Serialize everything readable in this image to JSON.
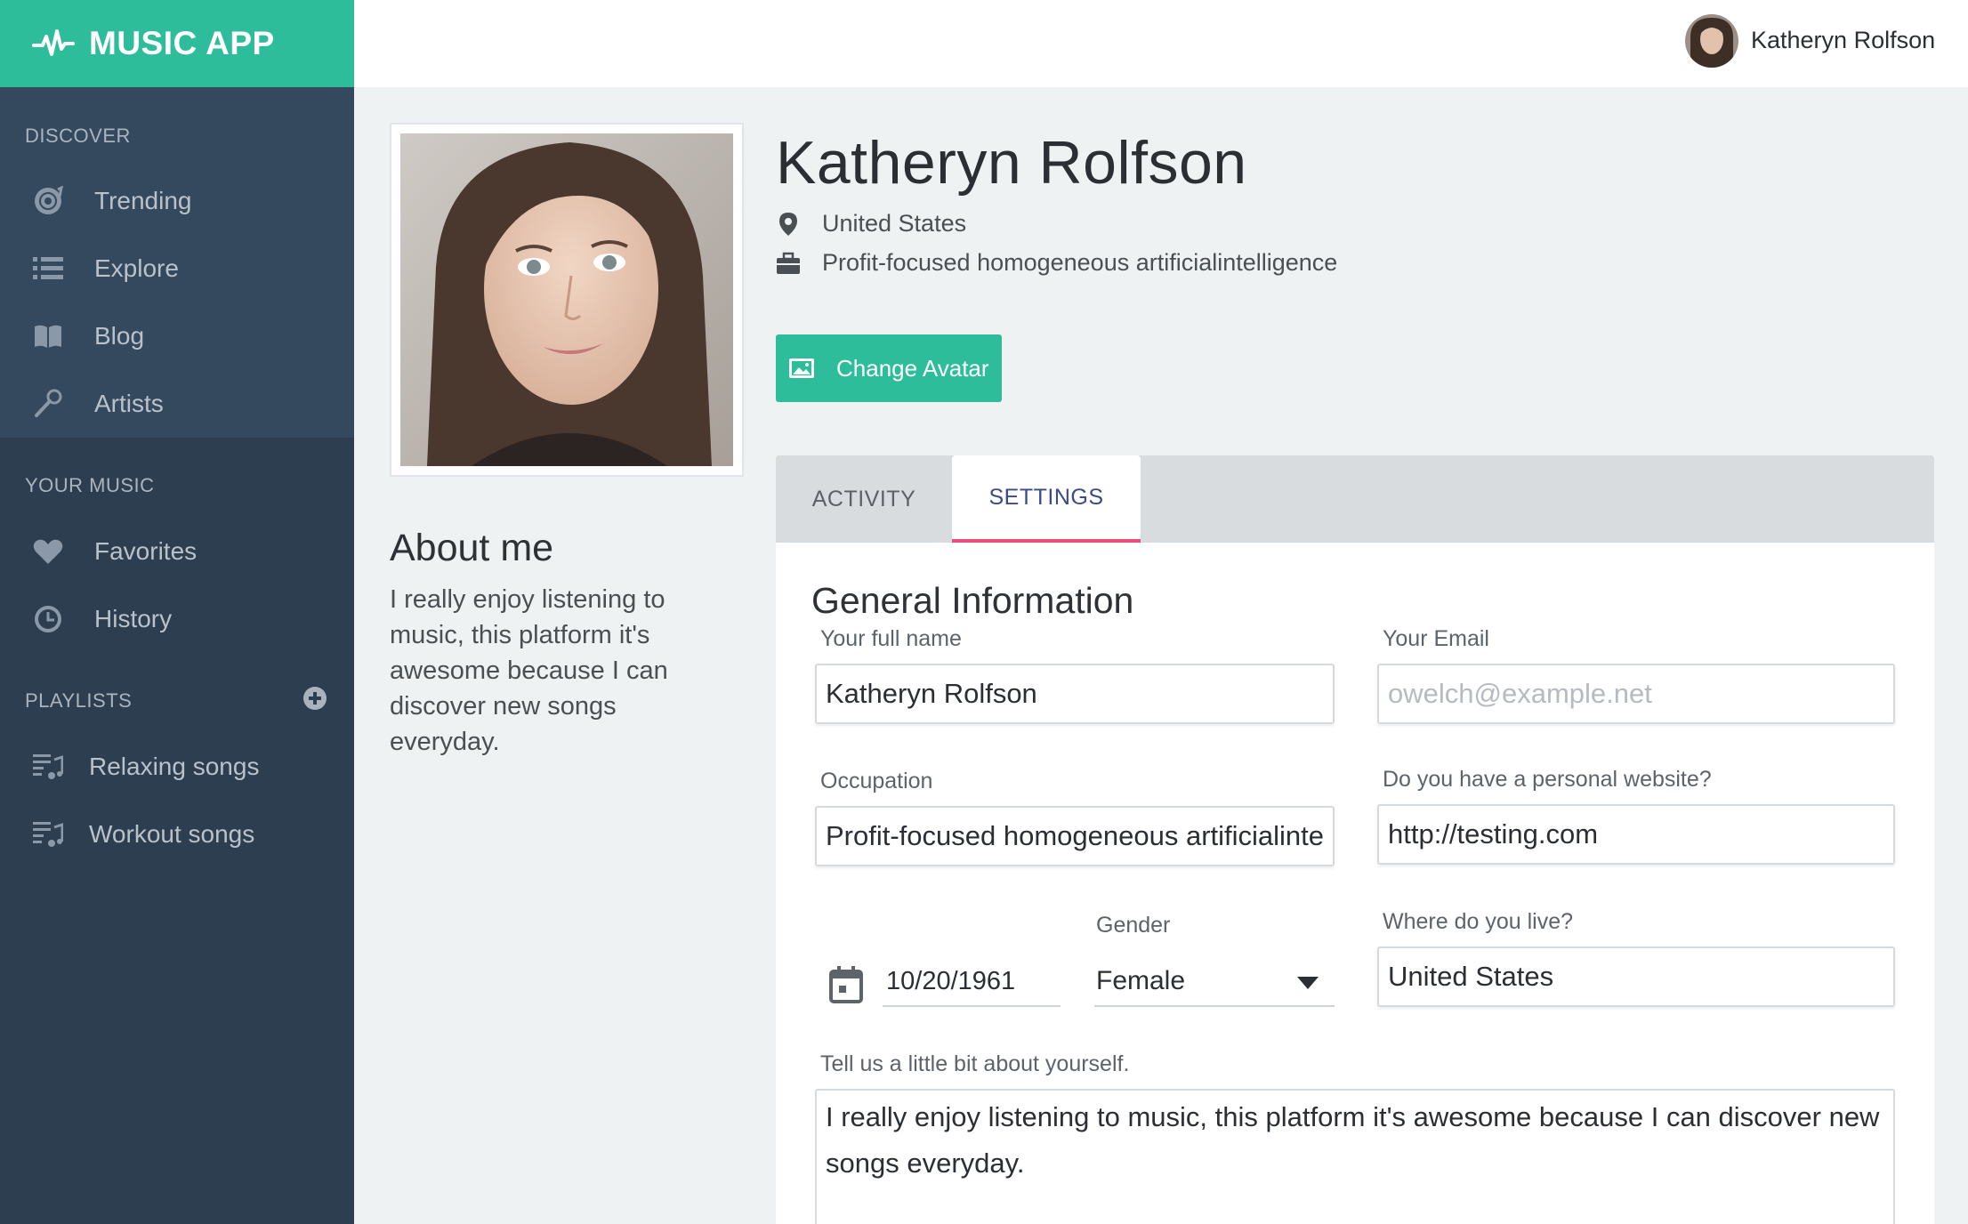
{
  "brand": {
    "name": "MUSIC APP",
    "color": "#2ebd9b"
  },
  "sidebar": {
    "discover_title": "DISCOVER",
    "discover": [
      {
        "label": "Trending",
        "icon": "disc-icon"
      },
      {
        "label": "Explore",
        "icon": "list-icon"
      },
      {
        "label": "Blog",
        "icon": "book-icon"
      },
      {
        "label": "Artists",
        "icon": "microphone-icon"
      }
    ],
    "your_music_title": "YOUR MUSIC",
    "your_music": [
      {
        "label": "Favorites",
        "icon": "heart-icon"
      },
      {
        "label": "History",
        "icon": "clock-icon"
      }
    ],
    "playlists_title": "PLAYLISTS",
    "playlists": [
      {
        "label": "Relaxing songs",
        "icon": "playlist-icon"
      },
      {
        "label": "Workout songs",
        "icon": "playlist-icon"
      }
    ]
  },
  "topbar": {
    "user_name": "Katheryn Rolfson"
  },
  "profile": {
    "name": "Katheryn Rolfson",
    "location": "United States",
    "occupation": "Profit-focused homogeneous artificialintelligence",
    "change_avatar_label": "Change Avatar",
    "about_title": "About me",
    "about_text": "I really enjoy listening to music, this platform it's awesome because I can discover new songs everyday."
  },
  "tabs": {
    "activity": "ACTIVITY",
    "settings": "SETTINGS",
    "active": "settings"
  },
  "form": {
    "title": "General Information",
    "full_name_label": "Your full name",
    "full_name_value": "Katheryn Rolfson",
    "email_label": "Your Email",
    "email_placeholder": "owelch@example.net",
    "occupation_label": "Occupation",
    "occupation_value": "Profit-focused homogeneous artificialintelligence",
    "website_label": "Do you have a personal website?",
    "website_value": "http://testing.com",
    "birthdate_value": "10/20/1961",
    "gender_label": "Gender",
    "gender_value": "Female",
    "location_label": "Where do you live?",
    "location_value": "United States",
    "bio_label": "Tell us a little bit about yourself.",
    "bio_value": "I really enjoy listening to music, this platform it's awesome because I can discover new songs everyday."
  }
}
